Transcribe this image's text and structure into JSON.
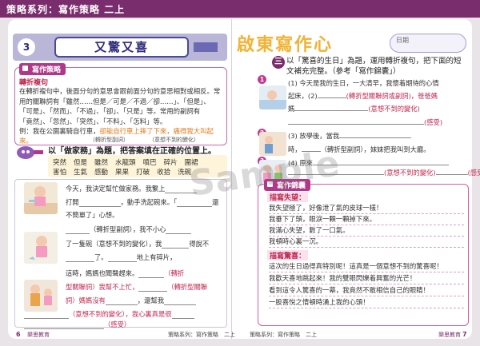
{
  "header": {
    "series": "策略系列：寫作策略 二上"
  },
  "left": {
    "lesson_number": "3",
    "lesson_title": "又驚又喜",
    "strategy_tag": "寫作策略",
    "strategy_subtitle": "轉折複句",
    "strategy_text": [
      "在轉折複句中，後面分句的意思會跟前面分句的意思相對或相反。常",
      "用的關聯詞有「雖然……但是／可是／不過／卻……」、「但是」、",
      "「可是」、「然而」、「不過」、「卻」、「只是」等。常用的副詞有",
      "「竟然」、「忽然」、「突然」、「不料」、「怎料」等。"
    ],
    "example_label": "例：",
    "example_text": "我在公園裏騎自行車，",
    "example_text_2": "卻能自行車上摔了下來，痛得我大叫起來。",
    "example_note_1": "（轉折型副詞）",
    "example_note_2": "（意想不到的變化）",
    "exercise_instruction": "以「做家務」為題，把答案填在正確的位置上。",
    "word_bank_row1": [
      "突然",
      "但是",
      "雖然",
      "水龍頭",
      "噴巴",
      "碎片",
      "圍裙"
    ],
    "word_bank_row2": [
      "害怕",
      "生氣",
      "感動",
      "果果",
      "打破",
      "收拾",
      "洗碗"
    ],
    "story": [
      "今天，我決定幫忙做家務。我繫上",
      "打開",
      "，動手洗起碗來。「",
      "還",
      "不簡單了」心想。",
      "（轉折型副詞），我不小心",
      "了一隻碗（意想不到的變化），我",
      "得說不",
      "了。",
      "地上有碎片，",
      "這時，媽媽也聞聲趕來。",
      "（轉折",
      "型關聯詞）我幫不上忙，",
      "（轉折型關聯",
      "詞）媽媽沒有",
      "，還幫我",
      "（意想不到的變化），我心裏真是很",
      "（感受）"
    ],
    "page_number": "6",
    "footer": "策略系列：寫作策略　二上",
    "publisher": "樂思教育"
  },
  "right": {
    "deco_title": "啟東寫作心",
    "date_label": "日期",
    "instr_num": "三",
    "instruction": "以「驚喜的生日」為題，運用轉折複句，把下面的短文補充完整。（參考「寫作錦囊」）",
    "items": [
      {
        "num": "1",
        "lines": [
          "(1) 今天是我的生日，一大清早，我懷着期待的心情",
          "起床，(2)",
          "(轉折型關聯詞或副詞)，爸爸媽",
          "媽",
          "(意想不到的變化)",
          "(感受)"
        ]
      },
      {
        "num": "2",
        "lines": [
          "(3) 放學後，當我",
          "時，",
          "（轉折型副詞），妹妹把我叫到大廳。"
        ]
      },
      {
        "num": "3",
        "lines": [
          "(4) 原來",
          "(意想不到的變化)",
          "(感受)"
        ]
      }
    ],
    "tips_tag": "寫作錦囊",
    "tip_head_1": "描寫失望：",
    "tips_1": [
      "我失望極了，好像泄了氣的皮球一樣！",
      "我垂下了頭，眼淚一顆一顆掉下來。",
      "我滿心失望，數了一口氣。",
      "我頓時心裏一沉。"
    ],
    "tip_head_2": "描寫驚喜：",
    "tips_2": [
      "這次的生日過得真特別呢！這真是一個意想不到的驚喜呢！",
      "我歡天喜地跳起來！我的雙眼閃爍着興奮的光芒！",
      "看到這令人驚喜的一幕，我竟然不敢相信自己的眼睛！",
      "一股喜悅之情頓時湧上我的心頭！"
    ],
    "page_number": "7",
    "footer": "策略系列：寫作策略　二上",
    "publisher": "樂思教育"
  },
  "watermark": "Sample"
}
